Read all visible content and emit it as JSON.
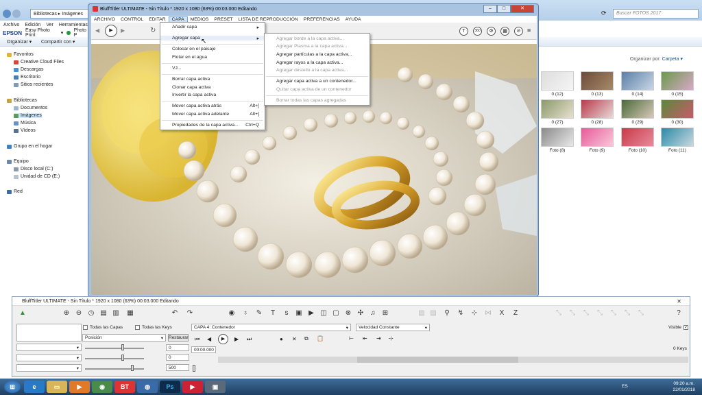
{
  "explorer": {
    "address": [
      "Bibliotecas",
      "Imágenes"
    ],
    "search_placeholder": "Buscar FOTOS 2017",
    "menu": [
      "Archivo",
      "Edición",
      "Ver",
      "Herramientas"
    ],
    "epson": {
      "brand": "EPSON",
      "label": "Easy Photo Print",
      "photo": "Photo P"
    },
    "toolbar": {
      "organize": "Organizar ▾",
      "share": "Compartir con ▾"
    },
    "sort": {
      "label": "Organizar por:",
      "value": "Carpeta ▾"
    },
    "nav": [
      {
        "label": "Favoritos",
        "level": 0
      },
      {
        "label": "Creative Cloud Files",
        "level": 1
      },
      {
        "label": "Descargas",
        "level": 1
      },
      {
        "label": "Escritorio",
        "level": 1
      },
      {
        "label": "Sitios recientes",
        "level": 1
      },
      {
        "label": "Bibliotecas",
        "level": 0
      },
      {
        "label": "Documentos",
        "level": 1
      },
      {
        "label": "Imágenes",
        "level": 1,
        "selected": true
      },
      {
        "label": "Música",
        "level": 1
      },
      {
        "label": "Vídeos",
        "level": 1
      },
      {
        "label": "Grupo en el hogar",
        "level": 0
      },
      {
        "label": "Equipo",
        "level": 0
      },
      {
        "label": "Disco local (C:)",
        "level": 1
      },
      {
        "label": "Unidad de CD (E:)",
        "level": 1
      },
      {
        "label": "Red",
        "level": 0
      }
    ],
    "thumbs": [
      "0 (12)",
      "0 (13)",
      "0 (14)",
      "0 (15)",
      "0 (27)",
      "0 (28)",
      "0 (29)",
      "0 (30)",
      "Foto (8)",
      "Foto (9)",
      "Foto (10)",
      "Foto (11)"
    ]
  },
  "bt": {
    "title": "BluffTitler ULTIMATE  - Sin Título * 1920 x 1080 (63%) 00:03.000 Editando",
    "menubar": [
      "ARCHIVO",
      "CONTROL",
      "EDITAR",
      "CAPA",
      "MEDIOS",
      "PRESET",
      "LISTA DE REPRODUCCIÓN",
      "PREFERENCIAS",
      "AYUDA"
    ],
    "active_menu": "CAPA",
    "capa_menu": [
      {
        "label": "Añadir capa",
        "arrow": true
      },
      {
        "label": "Agregar capa",
        "arrow": true,
        "highlight": true
      },
      {
        "label": "Colocar en el paisaje"
      },
      {
        "label": "Flotar en el agua"
      },
      {
        "label": "VJ..."
      },
      {
        "label": "Borrar capa activa"
      },
      {
        "label": "Clonar capa activa"
      },
      {
        "label": "Invertir la capa activa"
      },
      {
        "label": "Mover capa activa atrás",
        "shortcut": "Alt+["
      },
      {
        "label": "Mover capa activa adelante",
        "shortcut": "Alt+]"
      },
      {
        "label": "Propiedades de la capa activa...",
        "shortcut": "Ctrl+Q"
      }
    ],
    "sub_menu": [
      {
        "label": "Agregar borde a la capa activa...",
        "disabled": true
      },
      {
        "label": "Agregar Plasma a la capa activa...",
        "disabled": true
      },
      {
        "label": "Agregar partículas a la capa activa...",
        "disabled": false
      },
      {
        "label": "Agregar rayos a la capa activa...",
        "disabled": false
      },
      {
        "label": "Agregar destello a la capa activa...",
        "disabled": true
      },
      {
        "label": "Agregar capa activa a un contenedor...",
        "disabled": false
      },
      {
        "label": "Quitar capa activa de un contenedor",
        "disabled": true
      },
      {
        "label": "Borrar todas las capas agregadas",
        "disabled": true
      }
    ]
  },
  "ctl": {
    "title": "BluffTitler ULTIMATE  - Sin Título * 1920 x 1080 (63%) 00:03.000 Editando",
    "close": "✕",
    "all_layers": "Todas las Capas",
    "all_keys": "Todas las Keys",
    "layer_select": "CAPA 4: Contenedor",
    "speed_select": "Velocidad Constante",
    "position_select": "Posición",
    "restore_btn": "Restaurar",
    "visible": "Visible",
    "time": "00:00.000",
    "keys": "0 Keys",
    "values": [
      "0",
      "0",
      "500"
    ]
  },
  "taskbar": {
    "lang": "ES",
    "time": "09:20 a.m.",
    "date": "22/01/2018"
  }
}
